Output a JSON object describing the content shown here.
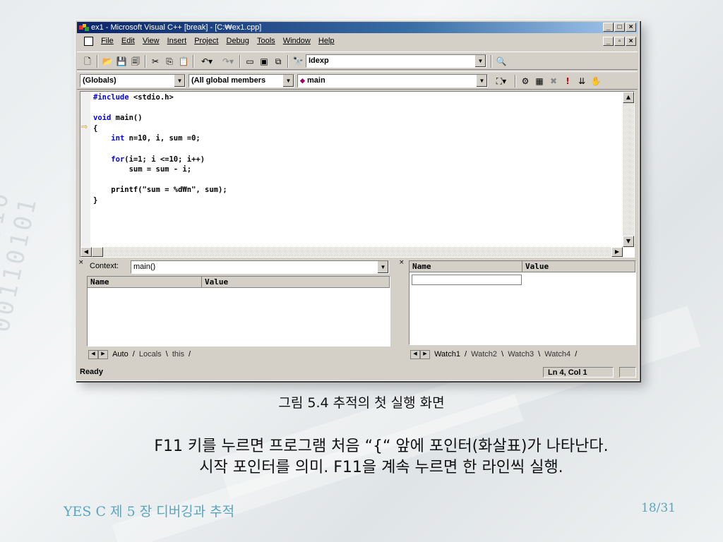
{
  "window": {
    "title": "ex1 - Microsoft Visual C++ [break] - [C:\\ex1.cpp]",
    "title_display": "ex1 - Microsoft Visual C++ [break] - [C:₩ex1.cpp]"
  },
  "menu": {
    "items": [
      "File",
      "Edit",
      "View",
      "Insert",
      "Project",
      "Debug",
      "Tools",
      "Window",
      "Help"
    ]
  },
  "toolbar": {
    "find_combo": "Idexp",
    "scope_combo": "(Globals)",
    "members_combo": "(All global members",
    "function_combo": "main"
  },
  "editor": {
    "lines": [
      "#include <stdio.h>",
      "",
      "void main()",
      "{",
      "    int n=10, i, sum =0;",
      "",
      "    for(i=1; i <=10; i++)",
      "        sum = sum - i;",
      "",
      "    printf(\"sum = %d₩n\", sum);",
      "}"
    ]
  },
  "variables_pane": {
    "context_label": "Context:",
    "context_value": "main()",
    "col_name": "Name",
    "col_value": "Value",
    "tabs": [
      "Auto",
      "Locals",
      "this"
    ]
  },
  "watch_pane": {
    "col_name": "Name",
    "col_value": "Value",
    "tabs": [
      "Watch1",
      "Watch2",
      "Watch3",
      "Watch4"
    ]
  },
  "status": {
    "ready": "Ready",
    "position": "Ln 4, Col 1"
  },
  "slide": {
    "caption": "그림 5.4  추적의 첫 실행 화면",
    "desc_line1": "F11 키를 누르면 프로그램 처음 “{“ 앞에 포인터(화살표)가 나타난다.",
    "desc_line2": "시작 포인터를 의미. F11을 계속 누르면 한 라인씩 실행.",
    "footer_left": "YES C  제 5 장 디버깅과 추적",
    "page": "18/31"
  },
  "colors": {
    "titlebar_start": "#0a246a",
    "keyword": "#0000ff",
    "footer": "#5aa6bf",
    "pointer_arrow": "#d4a000"
  }
}
